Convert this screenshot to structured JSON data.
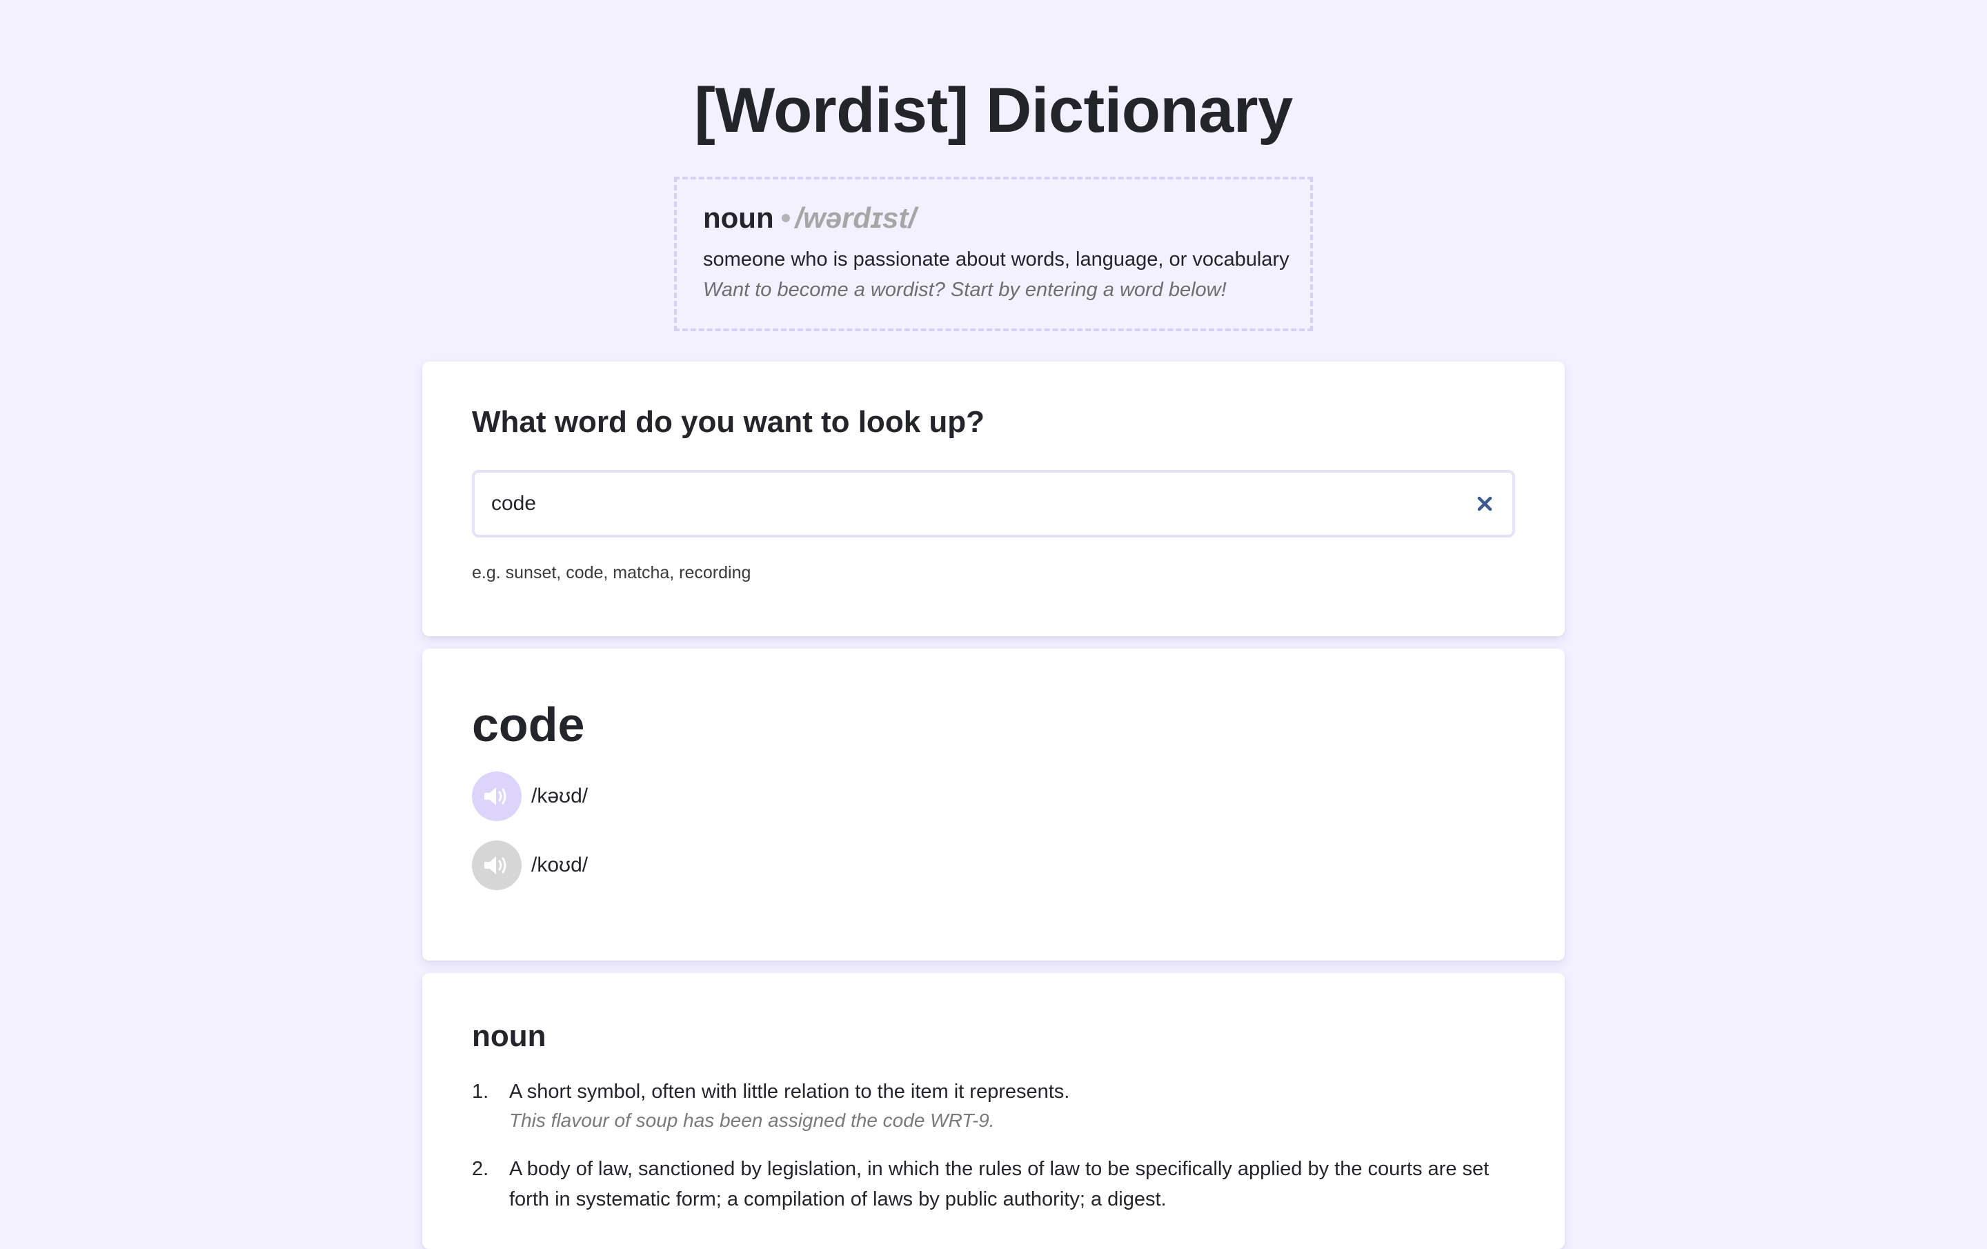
{
  "app": {
    "title": "[Wordist] Dictionary"
  },
  "tagline": {
    "part_of_speech": "noun",
    "separator": "•",
    "phonetic": "/wərdɪst/",
    "definition": "someone who is passionate about words, language, or vocabulary",
    "cta": "Want to become a wordist? Start by entering a word below!"
  },
  "search": {
    "heading": "What word do you want to look up?",
    "value": "code",
    "clear_icon": "close-icon",
    "hint": "e.g. sunset, code, matcha, recording"
  },
  "result": {
    "word": "code",
    "pronunciations": [
      {
        "text": "/kəʊd/",
        "state": "active",
        "icon": "speaker-icon"
      },
      {
        "text": "/koʊd/",
        "state": "inactive",
        "icon": "speaker-icon"
      }
    ]
  },
  "meanings": {
    "part_of_speech": "noun",
    "definitions": [
      {
        "number": "1.",
        "text": "A short symbol, often with little relation to the item it represents.",
        "example": "This flavour of soup has been assigned the code WRT-9."
      },
      {
        "number": "2.",
        "text": "A body of law, sanctioned by legislation, in which the rules of law to be specifically applied by the courts are set forth in systematic form; a compilation of laws by public authority; a digest.",
        "example": ""
      }
    ]
  },
  "colors": {
    "background": "#f3f0ff",
    "card": "#ffffff",
    "accent_light": "#ddd4fb",
    "text": "#23252b",
    "muted": "#7a7a7a",
    "clear_icon": "#3d5a8c"
  }
}
